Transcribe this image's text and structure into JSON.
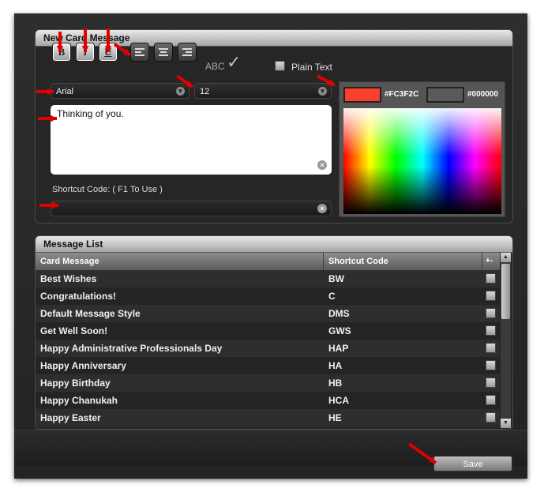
{
  "new_card_panel": {
    "title": "New Card Message",
    "format_buttons": {
      "bold": "B",
      "italic": "I",
      "underline": "U"
    },
    "spellcheck_label": "ABC",
    "spellcheck_mark": "✓",
    "plain_text_label": "Plain Text",
    "font": "Arial",
    "font_size": "12",
    "message_text": "Thinking of you.",
    "shortcut_label": "Shortcut Code: ( F1 To Use )",
    "shortcut_value": ""
  },
  "color_picker": {
    "foreground_hex": "#FC3F2C",
    "background_hex": "#000000",
    "foreground_color": "#fc3f2c",
    "background_color": "#5a5a5a"
  },
  "message_list": {
    "title": "Message List",
    "columns": [
      "Card Message",
      "Shortcut Code",
      "+-"
    ],
    "rows": [
      {
        "message": "Best Wishes",
        "code": "BW"
      },
      {
        "message": "Congratulations!",
        "code": "C"
      },
      {
        "message": "Default Message Style",
        "code": "DMS"
      },
      {
        "message": "Get Well Soon!",
        "code": "GWS"
      },
      {
        "message": "Happy Administrative Professionals Day",
        "code": "HAP"
      },
      {
        "message": "Happy Anniversary",
        "code": "HA"
      },
      {
        "message": "Happy Birthday",
        "code": "HB"
      },
      {
        "message": "Happy Chanukah",
        "code": "HCA"
      },
      {
        "message": "Happy Easter",
        "code": "HE"
      }
    ]
  },
  "footer": {
    "save_label": "Save"
  },
  "accent_arrow_color": "#e00000"
}
